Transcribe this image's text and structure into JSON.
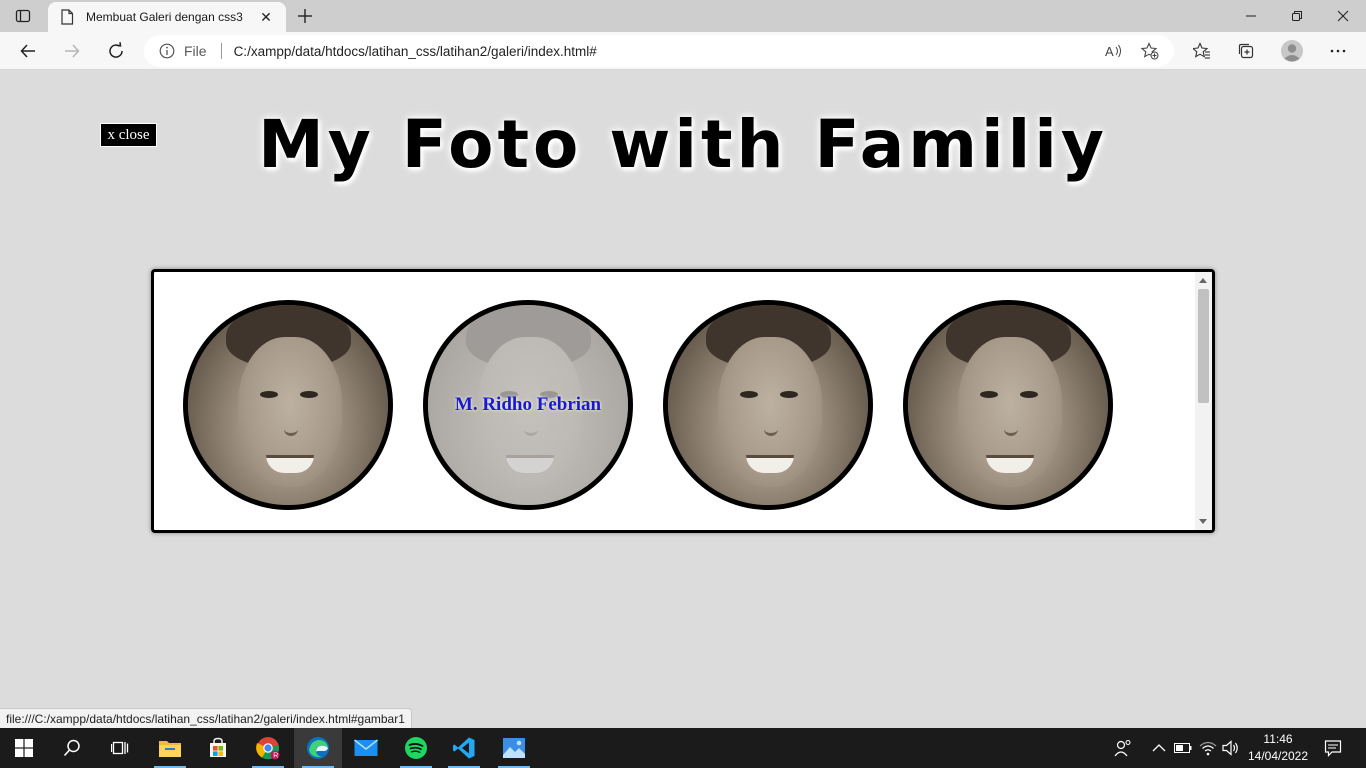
{
  "browser": {
    "tab_title": "Membuat Galeri dengan css3",
    "address_scheme_label": "File",
    "address_url": "C:/xampp/data/htdocs/latihan_css/latihan2/galeri/index.html#"
  },
  "page": {
    "close_link_label": "x close",
    "title": "My Foto with Familiy",
    "gallery": {
      "photos": [
        {
          "caption": ""
        },
        {
          "caption": "M. Ridho Febrian",
          "hovered": true
        },
        {
          "caption": ""
        },
        {
          "caption": ""
        }
      ]
    }
  },
  "status_bar": {
    "link": "file:///C:/xampp/data/htdocs/latihan_css/latihan2/galeri/index.html#gambar1"
  },
  "taskbar": {
    "apps": [
      "start-icon",
      "search-icon",
      "task-view-icon",
      "file-explorer-icon",
      "microsoft-store-icon",
      "chrome-icon",
      "edge-icon",
      "mail-icon",
      "spotify-icon",
      "vscode-icon",
      "photos-icon"
    ],
    "time": "11:46",
    "date": "14/04/2022"
  },
  "colors": {
    "page_background": "#dcdcdc",
    "caption_color": "#1a1acb",
    "taskbar": "#1b1b1b"
  }
}
